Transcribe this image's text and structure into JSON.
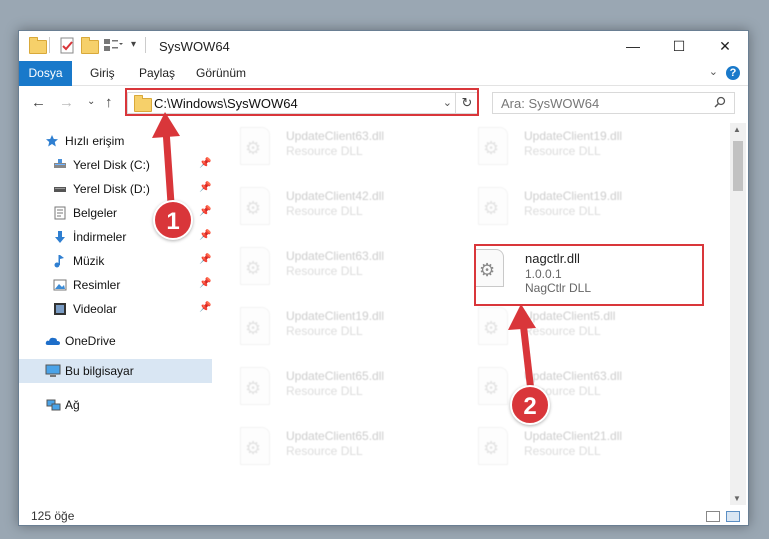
{
  "window": {
    "title": "SysWOW64",
    "controls": {
      "minimize": "—",
      "maximize": "☐",
      "close": "✕"
    }
  },
  "ribbon": {
    "tabs": [
      "Dosya",
      "Giriş",
      "Paylaş",
      "Görünüm"
    ],
    "help": "?"
  },
  "nav": {
    "address": "C:\\Windows\\SysWOW64",
    "search_placeholder": "Ara: SysWOW64"
  },
  "sidebar": {
    "items": [
      {
        "label": "Hızlı erişim",
        "icon": "star-icon",
        "pinned": false
      },
      {
        "label": "Yerel Disk (C:)",
        "icon": "drive-icon",
        "pinned": true
      },
      {
        "label": "Yerel Disk (D:)",
        "icon": "drive-icon",
        "pinned": true
      },
      {
        "label": "Belgeler",
        "icon": "documents-icon",
        "pinned": true
      },
      {
        "label": "İndirmeler",
        "icon": "download-icon",
        "pinned": true
      },
      {
        "label": "Müzik",
        "icon": "music-icon",
        "pinned": true
      },
      {
        "label": "Resimler",
        "icon": "pictures-icon",
        "pinned": true
      },
      {
        "label": "Videolar",
        "icon": "videos-icon",
        "pinned": true
      },
      {
        "label": "OneDrive",
        "icon": "cloud-icon",
        "pinned": false
      },
      {
        "label": "Bu bilgisayar",
        "icon": "computer-icon",
        "pinned": false
      },
      {
        "label": "Ağ",
        "icon": "network-icon",
        "pinned": false
      }
    ]
  },
  "files": {
    "left": [
      {
        "name": "UpdateClient63.dll",
        "desc": "Resource DLL"
      },
      {
        "name": "UpdateClient42.dll",
        "desc": "Resource DLL"
      },
      {
        "name": "UpdateClient63.dll",
        "desc": "Resource DLL"
      },
      {
        "name": "UpdateClient19.dll",
        "desc": "Resource DLL"
      },
      {
        "name": "UpdateClient65.dll",
        "desc": "Resource DLL"
      },
      {
        "name": "UpdateClient65.dll",
        "desc": "Resource DLL"
      }
    ],
    "right": [
      {
        "name": "UpdateClient19.dll",
        "desc": "Resource DLL"
      },
      {
        "name": "UpdateClient19.dll",
        "desc": "Resource DLL"
      },
      {
        "name": "UpdateClient5.dll",
        "desc": "Resource DLL"
      },
      {
        "name": "UpdateClient63.dll",
        "desc": "Resource DLL"
      },
      {
        "name": "UpdateClient21.dll",
        "desc": "Resource DLL"
      }
    ],
    "highlighted": {
      "name": "nagctlr.dll",
      "version": "1.0.0.1",
      "desc": "NagCtlr DLL"
    }
  },
  "status": {
    "count": "125 öğe"
  },
  "annotations": {
    "badge1": "1",
    "badge2": "2",
    "accent": "#d9363a"
  }
}
